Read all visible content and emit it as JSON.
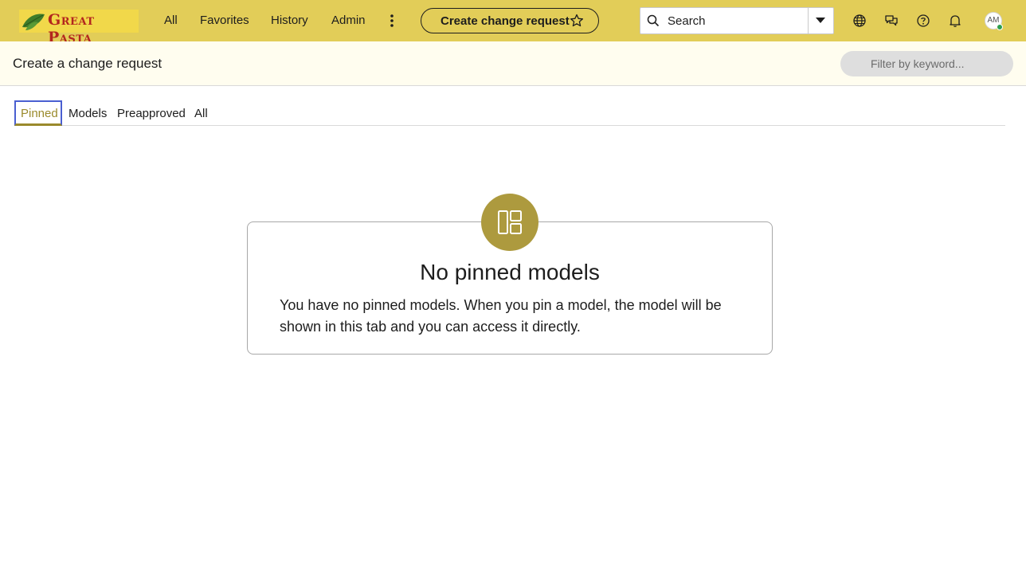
{
  "header": {
    "logo_text": "Great Pasta",
    "nav": [
      "All",
      "Favorites",
      "History",
      "Admin"
    ],
    "more_icon": "more-vertical-icon",
    "create_button_label": "Create change request",
    "search_placeholder": "Search",
    "icons": [
      "globe-icon",
      "chat-icon",
      "help-icon",
      "bell-icon"
    ],
    "avatar_initials": "AM",
    "bar_color": "#e2cd58"
  },
  "subheader": {
    "title": "Create a change request",
    "filter_placeholder": "Filter by keyword..."
  },
  "tabs": [
    {
      "label": "Pinned",
      "active": true
    },
    {
      "label": "Models",
      "active": false
    },
    {
      "label": "Preapproved",
      "active": false
    },
    {
      "label": "All",
      "active": false
    }
  ],
  "empty_state": {
    "icon": "layout-panels-icon",
    "title": "No pinned models",
    "message": "You have no pinned models. When you pin a model, the model will be shown in this tab and you can access it directly.",
    "accent_color": "#ad9a3e"
  }
}
